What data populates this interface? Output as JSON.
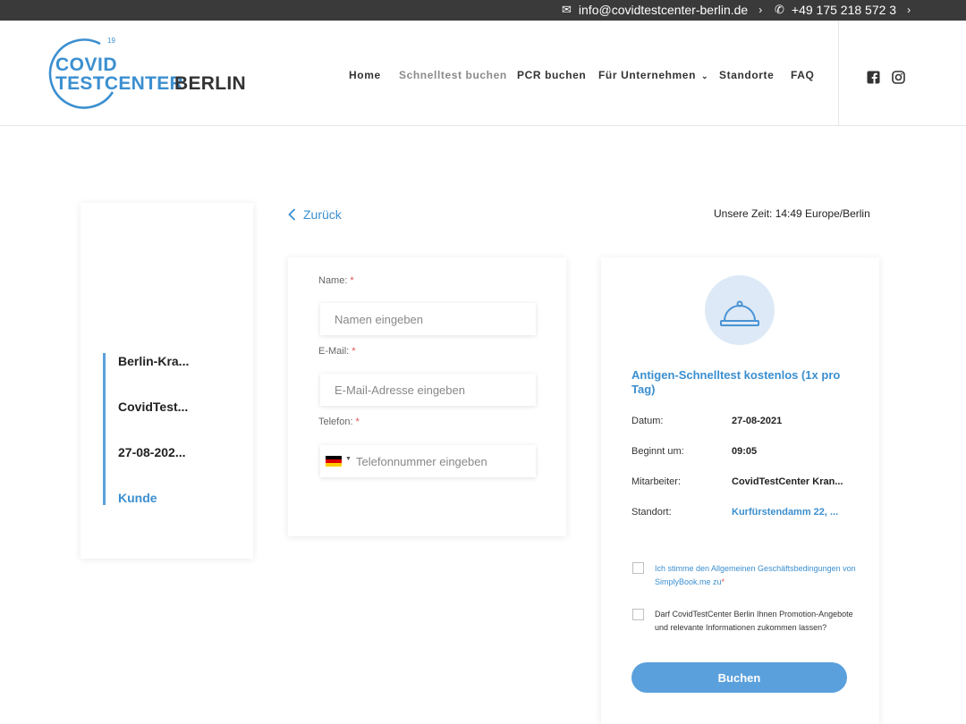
{
  "topbar": {
    "email": "info@covidtestcenter-berlin.de",
    "phone": "+49 175 218 572 3"
  },
  "logo": {
    "line1": "COVID",
    "line2": "TESTCENTER",
    "line3": "BERLIN",
    "superscript": "19"
  },
  "nav": {
    "items": [
      "Home",
      "Schnelltest buchen",
      "PCR buchen",
      "Für Unternehmen",
      "Standorte",
      "FAQ"
    ],
    "active_index": 1
  },
  "social": [
    "facebook-icon",
    "instagram-icon"
  ],
  "steps": {
    "items": [
      "Berlin-Kra...",
      "CovidTest...",
      "27-08-202...",
      "Kunde"
    ],
    "active_index": 3
  },
  "back_label": "Zurück",
  "time_text": "Unsere Zeit: 14:49 Europe/Berlin",
  "form": {
    "name_label": "Name:",
    "name_placeholder": "Namen eingeben",
    "email_label": "E-Mail:",
    "email_placeholder": "E-Mail-Adresse eingeben",
    "phone_label": "Telefon:",
    "phone_placeholder": "Telefonnummer eingeben",
    "required_mark": "*"
  },
  "summary": {
    "service": "Antigen-Schnelltest kostenlos (1x pro Tag)",
    "rows": [
      {
        "key": "Datum:",
        "value": "27-08-2021"
      },
      {
        "key": "Beginnt um:",
        "value": "09:05"
      },
      {
        "key": "Mitarbeiter:",
        "value": "CovidTestCenter Kran..."
      },
      {
        "key": "Standort:",
        "value": "Kurfürstendamm 22, ..."
      }
    ],
    "terms_text": "Ich stimme den Allgemeinen Geschäftsbedingungen von SimplyBook.me zu",
    "promo_text": "Darf CovidTestCenter Berlin Ihnen Promotion-Angebote und relevante Informationen zukommen lassen?",
    "book_label": "Buchen"
  },
  "colors": {
    "accent": "#3b8fd0",
    "button": "#5aa0dc",
    "topbar": "#3a3a3a",
    "required": "#e05050"
  }
}
